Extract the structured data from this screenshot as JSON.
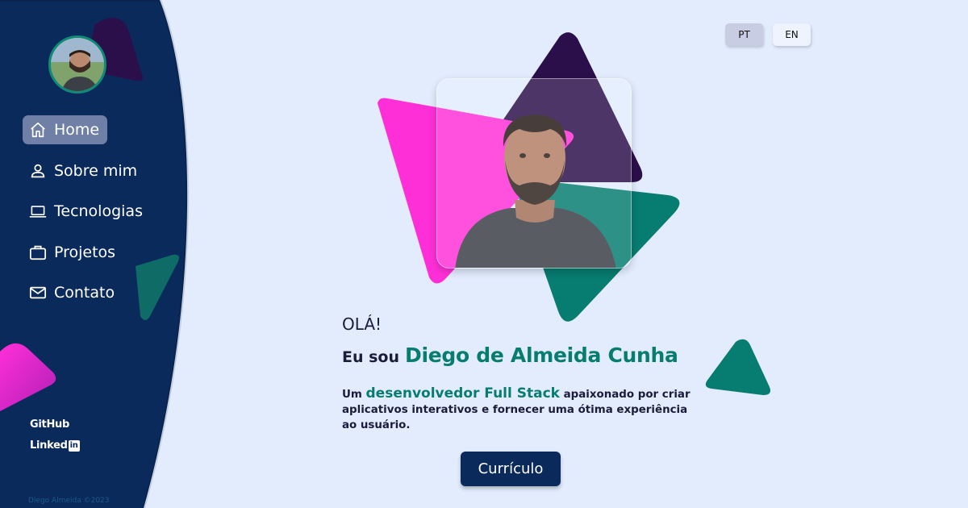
{
  "sidebar": {
    "items": [
      {
        "label": "Home",
        "icon": "home-icon",
        "active": true
      },
      {
        "label": "Sobre mim",
        "icon": "user-icon",
        "active": false
      },
      {
        "label": "Tecnologias",
        "icon": "laptop-icon",
        "active": false
      },
      {
        "label": "Projetos",
        "icon": "briefcase-icon",
        "active": false
      },
      {
        "label": "Contato",
        "icon": "mail-icon",
        "active": false
      }
    ],
    "social": {
      "github": "GitHub",
      "linkedin_text": "Linked",
      "linkedin_box": "in"
    },
    "copyright": "Diego Almeida ©2023"
  },
  "lang": {
    "pt": "PT",
    "en": "EN",
    "selected": "PT"
  },
  "hero": {
    "greeting": "OLÁ!",
    "intro_prefix": "Eu sou",
    "name": "Diego de Almeida Cunha",
    "desc_prefix": "Um",
    "desc_highlight": "desenvolvedor Full Stack",
    "desc_rest": "apaixonado por criar aplicativos interativos e fornecer uma ótima experiência ao usuário.",
    "cv_button": "Currículo"
  },
  "colors": {
    "sidebar": "#0b2a5c",
    "accent_teal": "#077c70",
    "accent_pink": "#ff2fd8",
    "accent_purple": "#2b0f4a",
    "background": "#e2ecfd"
  }
}
